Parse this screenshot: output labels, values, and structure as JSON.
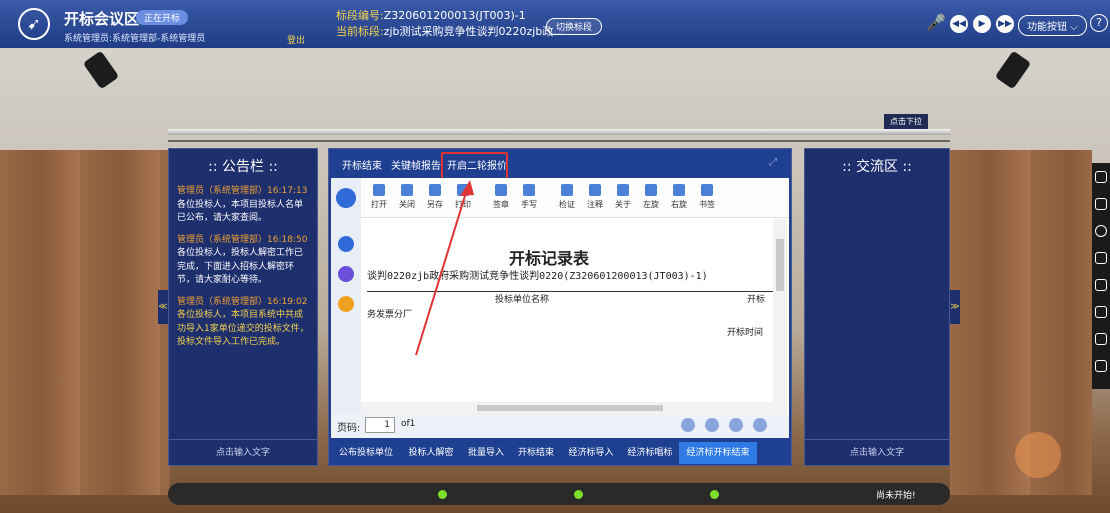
{
  "header": {
    "title": "开标会议区",
    "status_badge": "正在开标",
    "user": "系统管理员:系统管理部-系统管理员",
    "logout": "登出",
    "project_no_label": "标段编号:",
    "project_no": "Z320601200013(JT003)-1",
    "current_label": "当前标段:",
    "current": "zjb测试采购竞争性谈判0220zjb政...",
    "switch_btn": "切换标段",
    "func_btn": "功能按钮",
    "help": "?"
  },
  "stage": {
    "drop_btn": "点击下拉",
    "status_text": "尚未开始!"
  },
  "announcement": {
    "title": ":: 公告栏 ::",
    "items": [
      {
        "time": "管理员（系统管理部）16:17:13",
        "text": "各位投标人，本项目投标人名单已公布，请大家查阅。"
      },
      {
        "time": "管理员（系统管理部）16:18:50",
        "text": "各位投标人，投标人解密工作已完成，下面进入招标人解密环节，请大家耐心等待。"
      },
      {
        "time": "管理员（系统管理部）16:19:02",
        "text": "各位投标人，本项目系统中共成功导入1家单位递交的投标文件，投标文件导入工作已完成。"
      }
    ],
    "input_hint": "点击输入文字"
  },
  "chat": {
    "title": ":: 交流区 ::",
    "input_hint": "点击输入文字"
  },
  "center": {
    "tabs": [
      "开标结束",
      "关键帧报告",
      "开启二轮报价"
    ],
    "toolbar": [
      "打开",
      "关闭",
      "另存",
      "打印",
      "签章",
      "手写",
      "检证",
      "注释",
      "关于",
      "左旋",
      "右旋",
      "书签"
    ],
    "doc": {
      "title": "开标记录表",
      "subtitle": "谈判0220zjb政府采购测试竞争性谈判0220(Z320601200013(JT003)-1)",
      "col1": "投标单位名称",
      "col2": "开标",
      "row1": "务发票分厂",
      "row2": "开标时间"
    },
    "pager": {
      "label": "页码:",
      "page": "1",
      "of": "of1"
    },
    "bottom_buttons": [
      "公布投标单位",
      "投标人解密",
      "批量导入",
      "开标结束",
      "经济标导入",
      "经济标唱标",
      "经济标开标结束"
    ]
  },
  "colors": {
    "accent": "#2f7ae5",
    "panel": "#1e2f6e",
    "highlight": "#e03434",
    "warning": "#f5d24b"
  }
}
